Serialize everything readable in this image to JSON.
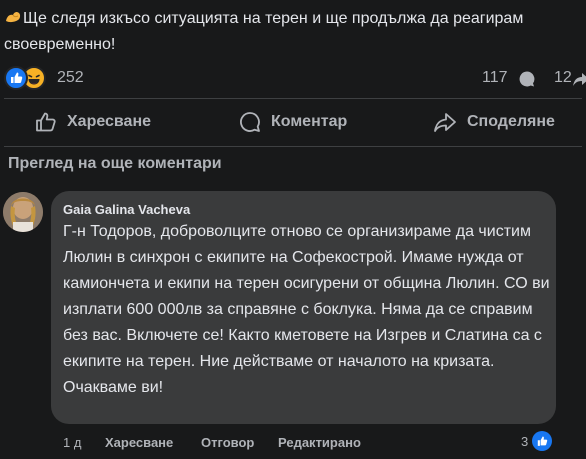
{
  "post": {
    "text": "Ще следя изкъсо ситуацията на терен и ще продължа да реагирам своевременно!",
    "reaction_count": "252",
    "comment_count": "117",
    "share_count": "12"
  },
  "actions": {
    "like": "Харесване",
    "comment": "Коментар",
    "share": "Споделяне"
  },
  "more_comments": "Преглед на още коментари",
  "comment": {
    "author": "Gaia Galina Vacheva",
    "text": "Г-н Тодоров, доброволците отново се организираме да чистим Люлин в синхрон с екипите на Софекострой. Имаме нужда от камиончета и екипи на терен осигурени от община Люлин. СО ви изплати 600 000лв за справяне с боклука. Няма да се справим без вас. Включете се! Както кметовете на Изгрев и Слатина са с екипите на терен. Ние действаме от началото на кризата. Очакваме ви!",
    "time": "1 д",
    "like": "Харесване",
    "reply": "Отговор",
    "edited": "Редактирано",
    "like_count": "3"
  },
  "colors": {
    "background": "#18191a",
    "bubble": "#3a3b3c",
    "text": "#e4e6eb",
    "secondary": "#b0b3b8",
    "like_blue": "#1877f2"
  },
  "icons": {
    "post_emoji": "flexed-biceps-icon",
    "reaction_1": "like-reaction-icon",
    "reaction_2": "haha-reaction-icon",
    "like": "thumbs-up-icon",
    "comment": "speech-bubble-icon",
    "share": "share-arrow-icon"
  }
}
